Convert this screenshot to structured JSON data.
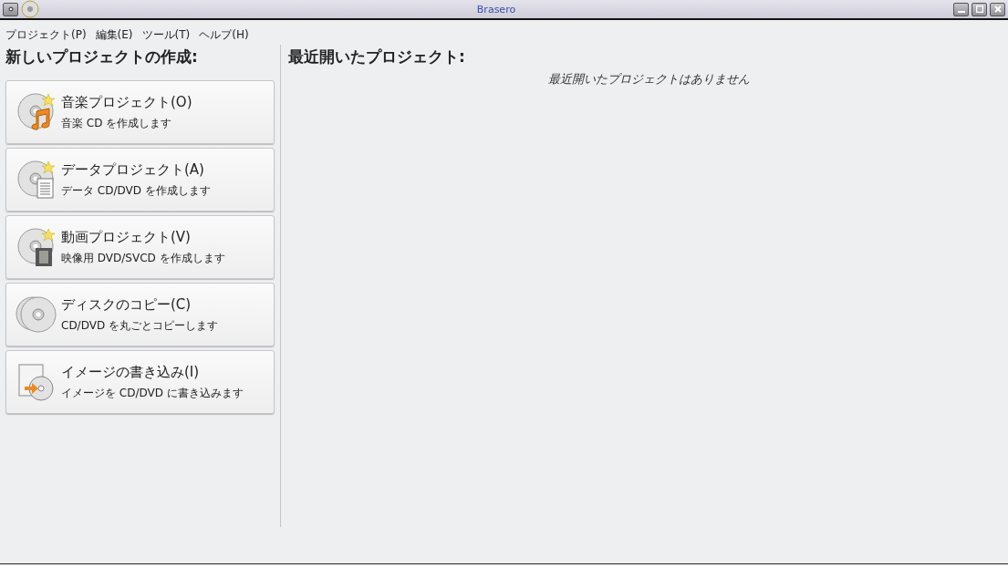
{
  "window": {
    "title": "Brasero"
  },
  "menu": [
    {
      "label": "プロジェクト(P)"
    },
    {
      "label": "編集(E)"
    },
    {
      "label": "ツール(T)"
    },
    {
      "label": "ヘルプ(H)"
    }
  ],
  "new_project": {
    "heading": "新しいプロジェクトの作成:",
    "items": [
      {
        "kind": "audio",
        "title": "音楽プロジェクト(O)",
        "description": "音楽 CD を作成します"
      },
      {
        "kind": "data",
        "title": "データプロジェクト(A)",
        "description": "データ CD/DVD を作成します"
      },
      {
        "kind": "video",
        "title": "動画プロジェクト(V)",
        "description": "映像用 DVD/SVCD を作成します"
      },
      {
        "kind": "copy",
        "title": "ディスクのコピー(C)",
        "description": "CD/DVD を丸ごとコピーします"
      },
      {
        "kind": "image",
        "title": "イメージの書き込み(I)",
        "description": "イメージを CD/DVD に書き込みます"
      }
    ]
  },
  "recent": {
    "heading": "最近開いたプロジェクト:",
    "empty_message": "最近開いたプロジェクトはありません"
  }
}
